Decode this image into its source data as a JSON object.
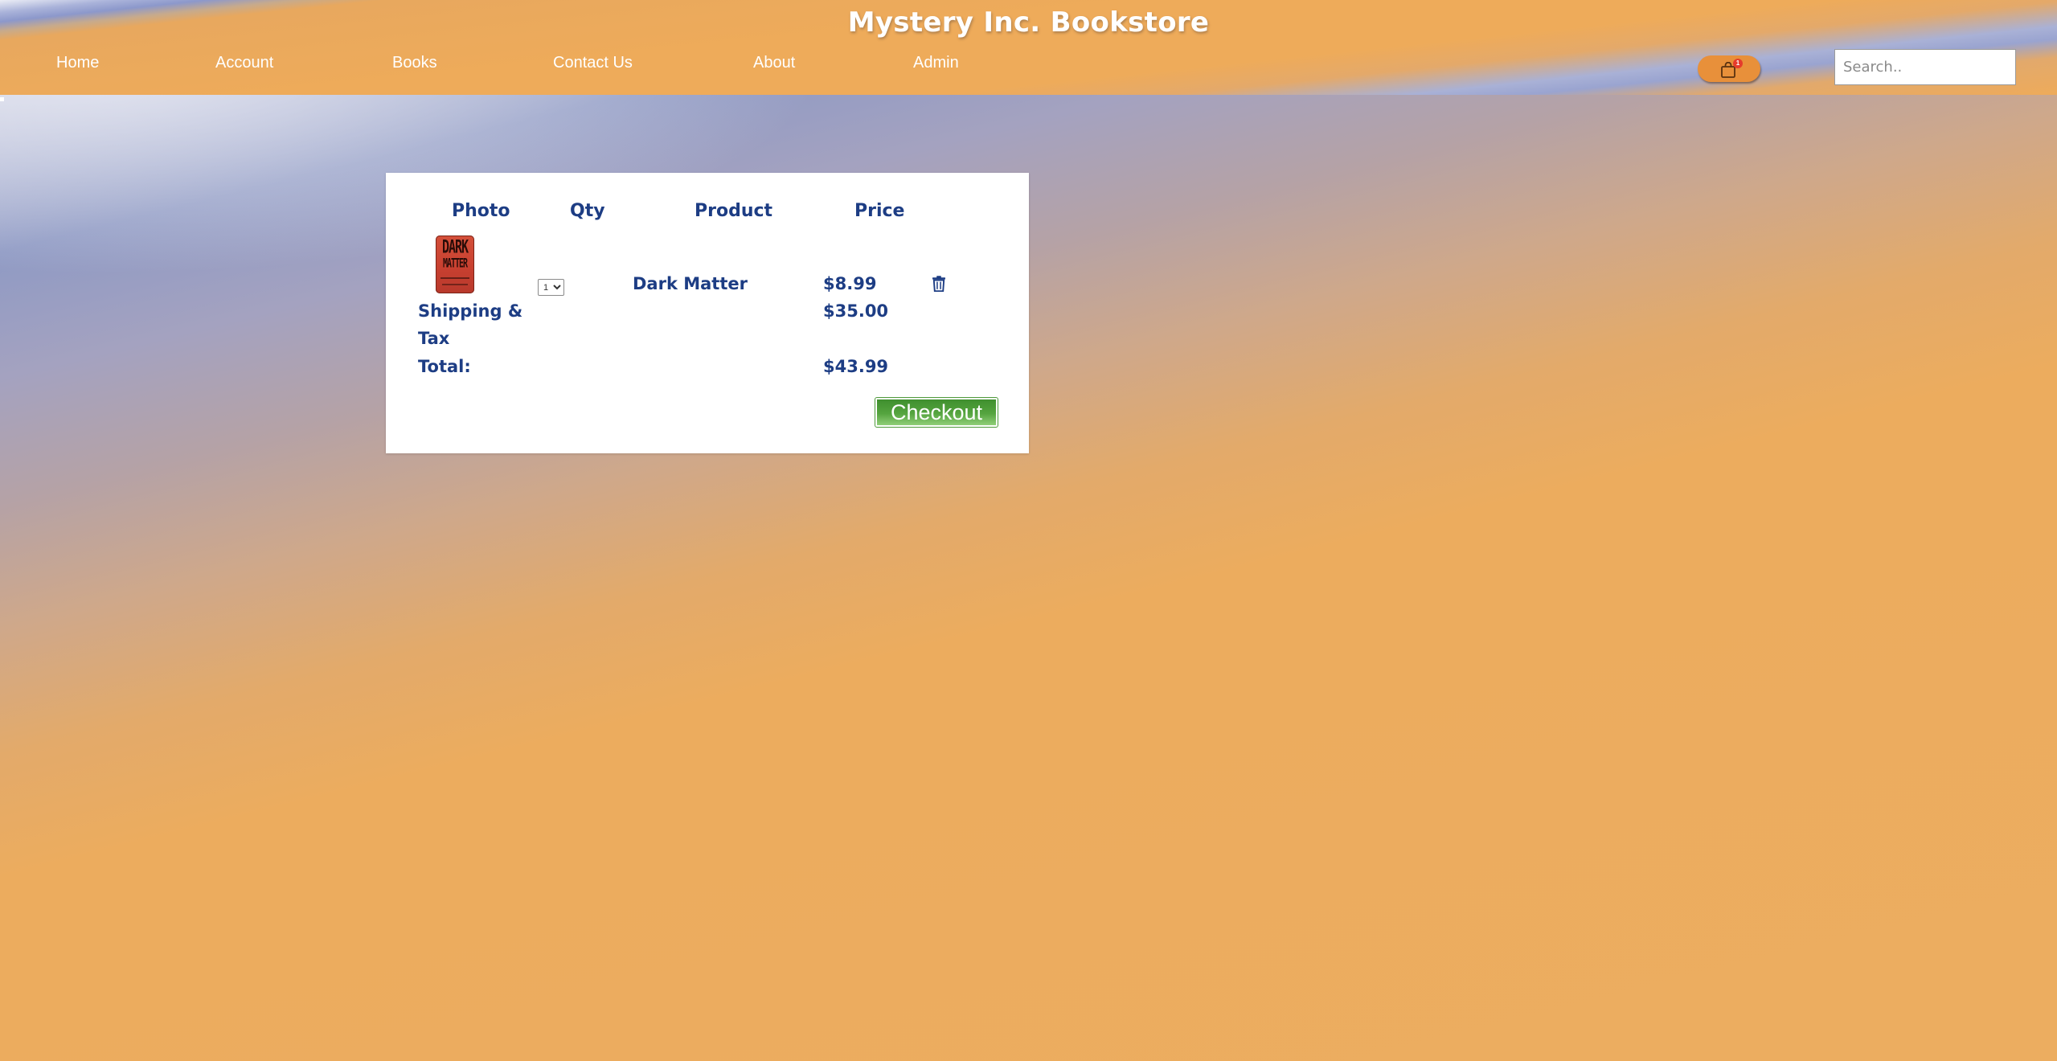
{
  "header": {
    "site_title": "Mystery Inc. Bookstore",
    "nav": [
      {
        "label": "Home"
      },
      {
        "label": "Account"
      },
      {
        "label": "Books"
      },
      {
        "label": "Contact Us"
      },
      {
        "label": "About"
      },
      {
        "label": "Admin"
      }
    ],
    "cart": {
      "icon": "shopping-bag-icon",
      "badge_count": "1"
    },
    "search": {
      "placeholder": "Search..",
      "value": ""
    }
  },
  "cart_table": {
    "headers": {
      "photo": "Photo",
      "qty": "Qty",
      "product": "Product",
      "price": "Price"
    },
    "items": [
      {
        "photo_alt": "Dark Matter book cover",
        "cover_lines": [
          "DARK",
          "MATTER"
        ],
        "qty": "1",
        "qty_options": [
          "1"
        ],
        "product": "Dark Matter",
        "price": "$8.99",
        "remove_icon": "trash-icon"
      }
    ],
    "shipping_label_line1": "Shipping &",
    "shipping_label_line2": "Tax",
    "shipping_value": "$35.00",
    "total_label": "Total:",
    "total_value": "$43.99",
    "checkout_label": "Checkout"
  },
  "colors": {
    "text_primary": "#1d3d84",
    "cart_button": "#e8903a",
    "badge": "#e53b2c",
    "checkout_green": "#4e9a3b",
    "header_orange": "#eeab5a"
  }
}
